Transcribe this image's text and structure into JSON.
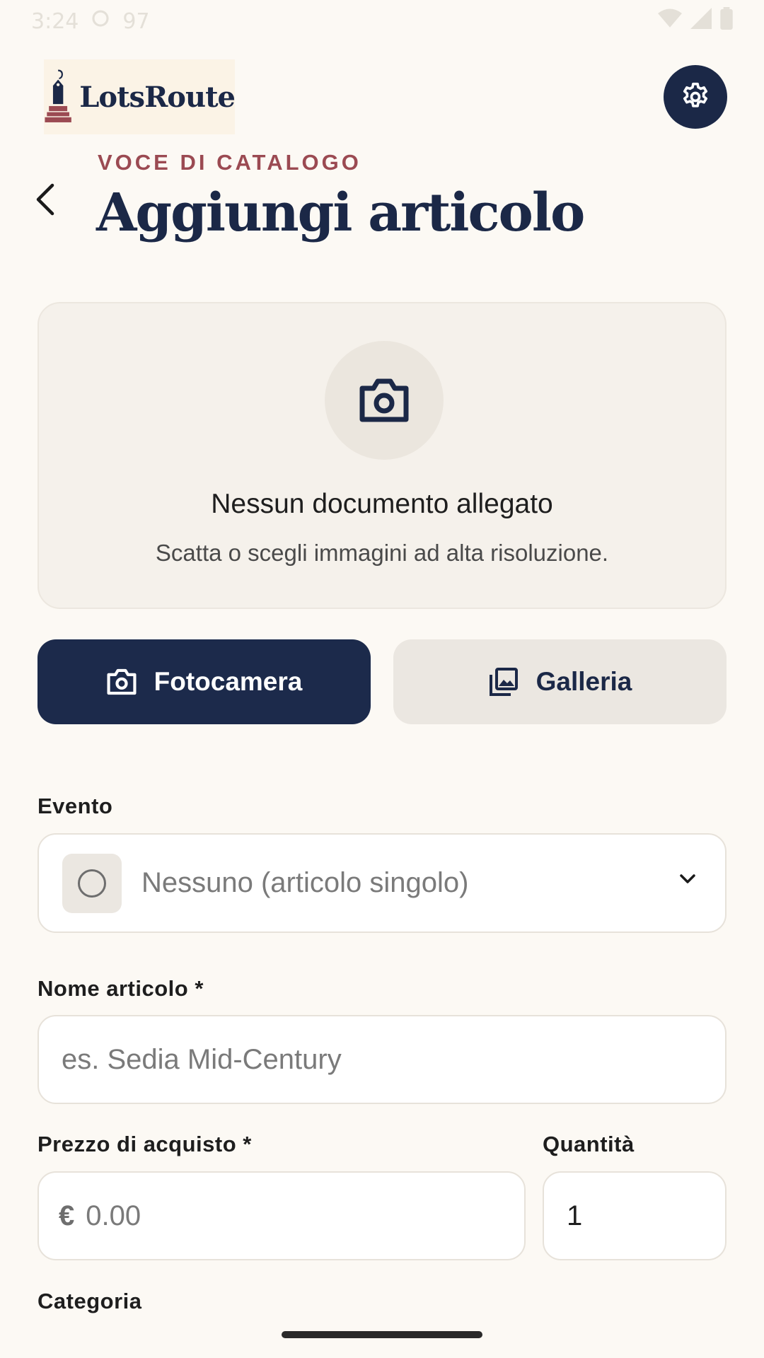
{
  "status_bar": {
    "time": "3:24",
    "extra": "97"
  },
  "header": {
    "logo_text": "LotsRoute",
    "eyebrow": "VOCE DI CATALOGO",
    "title": "Aggiungi articolo",
    "settings_icon": "gear-icon",
    "back_icon": "chevron-left-icon"
  },
  "attachment": {
    "icon": "camera-icon",
    "title": "Nessun documento allegato",
    "subtitle": "Scatta o scegli immagini ad alta risoluzione."
  },
  "actions": {
    "camera_label": "Fotocamera",
    "gallery_label": "Galleria"
  },
  "form": {
    "event": {
      "label": "Evento",
      "value": "Nessuno (articolo singolo)"
    },
    "name": {
      "label": "Nome articolo *",
      "placeholder": "es. Sedia Mid-Century"
    },
    "price": {
      "label": "Prezzo di acquisto *",
      "currency": "€",
      "placeholder": "0.00"
    },
    "quantity": {
      "label": "Quantità",
      "value": "1"
    },
    "category": {
      "label": "Categoria"
    }
  },
  "colors": {
    "background": "#fcf9f4",
    "primary": "#1b2847",
    "accent": "#9b4a52"
  }
}
